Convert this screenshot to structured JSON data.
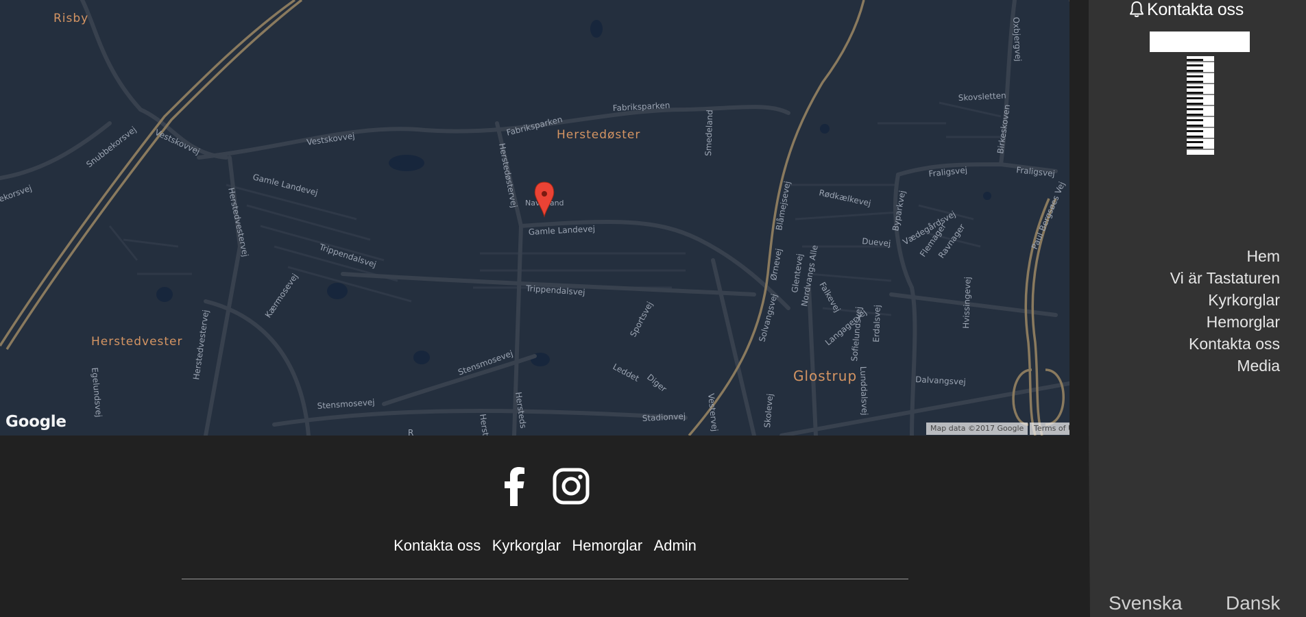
{
  "map": {
    "labels": {
      "risby": "Risby",
      "herstedoster": "Herstedøster",
      "herstedvester": "Herstedvester",
      "glostrup": "Glostrup",
      "fabriksparken1": "Fabriksparken",
      "fabriksparken2": "Fabriksparken",
      "vestskovvej1": "Vestskovvej",
      "vestskovvej2": "Vestskovvej",
      "snubbekorsvej": "Snubbekorsvej",
      "ekorsvej": "ekorsvej",
      "gamle_landevej1": "Gamle Landevej",
      "gamle_landevej2": "Gamle Landevej",
      "herstedoestervej": "Herstedøstervej",
      "herstedvestervej1": "Herstedvestervej",
      "herstedvestervej2": "Herstedvestervej",
      "trippendalsvej1": "Trippendalsvej",
      "trippendalsvej2": "Trippendalsvej",
      "kaermosevej": "Kærmosevej",
      "egelundsvej": "Egelundsvej",
      "stensmosevej1": "Stensmosevej",
      "stensmosevej2": "Stensmosevej",
      "sportsvej": "Sportsvej",
      "leddet": "Leddet",
      "diger": "Diger",
      "stadionvej": "Stadionvej",
      "smedeland": "Smedeland",
      "navervand": "Naverland",
      "skovsletten": "Skovsletten",
      "oxbjergvej": "Oxbjergvej",
      "birkeskoven": "Birkeskoven",
      "fraligsvej1": "Fraligsvej",
      "fraligsvej2": "Fraligsvej",
      "rodkaelkevej": "Rødkælkevej",
      "blamejsevej": "Blåmejsevej",
      "byparkvej": "Byparkvej",
      "vaedegardsvej": "Vædegårdsvej",
      "flemager": "Flemager",
      "ravnager": "Ravnager",
      "paul_bergsoes_vej": "Paul Bergsøes Vej",
      "duevej": "Duevej",
      "ormevej": "Ørnevej",
      "glentevej": "Glentevej",
      "nordvangs_alle": "Nordvangs Alle",
      "falkevej": "Falkevej",
      "langagervej": "Langagervej",
      "solvangsvej": "Solvangsvej",
      "sofielundsvej": "Sofielundsvej",
      "erdalsvej": "Erdalsvej",
      "lunddalsvej": "Lunddalsvej",
      "hvissingevej": "Hvissingevej",
      "dalvangsvej": "Dalvangsvej",
      "skolevej": "Skolevej",
      "vestervej": "Vestervej",
      "herstedsv": "Hersteds",
      "herst": "Herst",
      "r": "R"
    },
    "google_logo": "Google",
    "map_data": "Map data ©2017 Google",
    "terms": "Terms of Use",
    "marker_color": "#ea4335"
  },
  "footer": {
    "links": [
      "Kontakta oss",
      "Kyrkorglar",
      "Hemorglar",
      "Admin"
    ]
  },
  "sidebar": {
    "contact": "Kontakta oss",
    "nav": [
      "Hem",
      "Vi är Tastaturen",
      "Kyrkorglar",
      "Hemorglar",
      "Kontakta oss",
      "Media"
    ],
    "languages": {
      "sv": "Svenska",
      "da": "Dansk"
    }
  },
  "colors": {
    "map_bg": "#242f3e",
    "road": "#38414e",
    "highway": "#746855",
    "district_label": "#d59563",
    "road_label": "#9ca5b3",
    "footer_bg": "#212121",
    "sidebar_bg": "#333333"
  },
  "icons": {
    "facebook": "facebook-icon",
    "instagram": "instagram-icon",
    "bell": "bell-icon",
    "marker": "map-marker-icon",
    "logo": "piano-keys-logo"
  }
}
